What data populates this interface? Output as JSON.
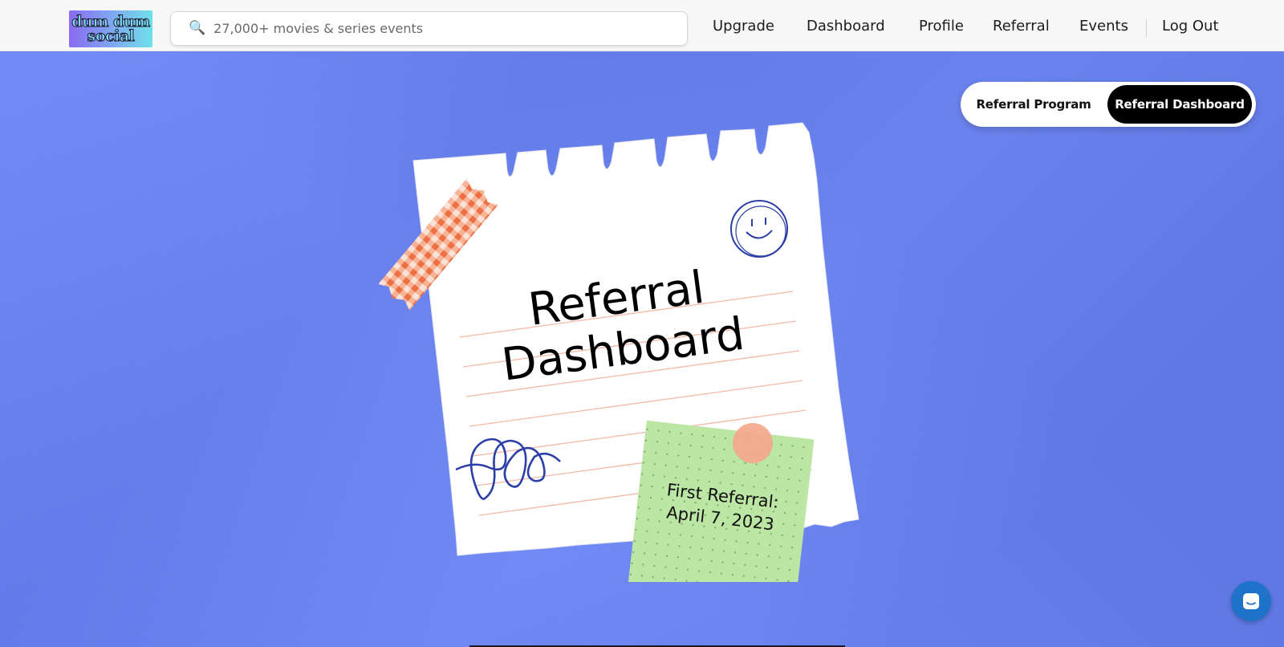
{
  "header": {
    "logo_line1": "dum dum",
    "logo_line2": "social",
    "search": {
      "icon": "search-icon",
      "placeholder": "27,000+ movies & series events"
    },
    "nav": [
      {
        "label": "Upgrade"
      },
      {
        "label": "Dashboard"
      },
      {
        "label": "Profile"
      },
      {
        "label": "Referral"
      },
      {
        "label": "Events"
      },
      {
        "label": "Log Out"
      }
    ]
  },
  "tabs": {
    "program": "Referral Program",
    "dashboard": "Referral Dashboard",
    "active": "dashboard"
  },
  "hero": {
    "title_line1": "Referral",
    "title_line2": "Dashboard",
    "sticky_line1": "First Referral:",
    "sticky_line2": "April 7, 2023"
  },
  "colors": {
    "background": "#6781f4",
    "paper": "#ffffff",
    "sticky_note": "#bce6a4",
    "tape": "#f07a4c",
    "pin": "#f4a88c",
    "doodle": "#2b3fa6",
    "chat_button": "#1e73c8"
  },
  "chat": {
    "icon": "chat-bubble-icon"
  }
}
